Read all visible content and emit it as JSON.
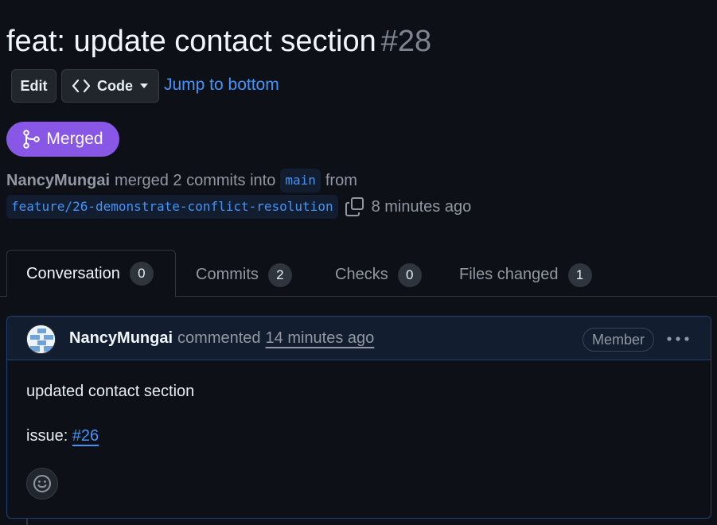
{
  "pr": {
    "title": "feat: update contact section",
    "number": "#28",
    "state": "Merged",
    "author": "NancyMungai",
    "merge_text": "merged 2 commits into",
    "base_branch": "main",
    "from_text": "from",
    "head_branch": "feature/26-demonstrate-conflict-resolution",
    "time": "8 minutes ago"
  },
  "toolbar": {
    "edit_label": "Edit",
    "code_label": "Code",
    "jump_label": "Jump to bottom"
  },
  "tabs": [
    {
      "label": "Conversation",
      "count": "0",
      "active": true
    },
    {
      "label": "Commits",
      "count": "2"
    },
    {
      "label": "Checks",
      "count": "0"
    },
    {
      "label": "Files changed",
      "count": "1"
    }
  ],
  "comment": {
    "author": "NancyMungai",
    "action": "commented",
    "time": "14 minutes ago",
    "role_badge": "Member",
    "body_line1": "updated contact section",
    "issue_prefix": "issue:",
    "issue_link": "#26"
  },
  "icons": {
    "code": "code-icon",
    "caret": "triangle-down-icon",
    "merge": "git-merge-icon",
    "copy": "copy-icon",
    "kebab": "kebab-horizontal-icon",
    "reaction": "smiley-icon"
  },
  "colors": {
    "background": "#0d1117",
    "merged": "#8957e5",
    "link": "#4493f8",
    "comment_header": "#121d2f",
    "comment_border": "#1f4272"
  }
}
